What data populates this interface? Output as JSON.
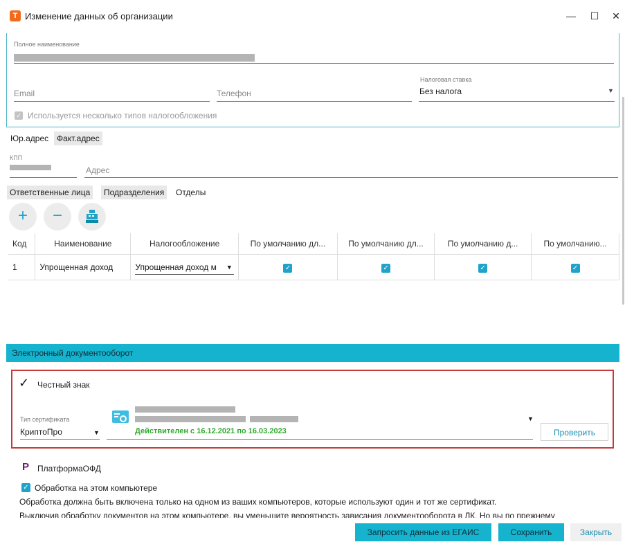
{
  "window": {
    "title": "Изменение данных об организации",
    "app_icon_letter": "Т",
    "controls": {
      "minimize": "—",
      "maximize": "☐",
      "close": "✕"
    }
  },
  "org": {
    "full_name_label": "Полное наименование",
    "email_placeholder": "Email",
    "phone_placeholder": "Телефон",
    "tax_rate_label": "Налоговая ставка",
    "tax_rate_value": "Без налога",
    "multi_tax_label": "Используется несколько типов налогообложения"
  },
  "address_tabs": [
    "Юр.адрес",
    "Факт.адрес"
  ],
  "address": {
    "kpp_label": "КПП",
    "address_placeholder": "Адрес"
  },
  "staff_tabs": [
    "Ответственные лица",
    "Подразделения",
    "Отделы"
  ],
  "toolbar": {
    "add": "+",
    "remove": "−"
  },
  "table": {
    "headers": [
      "Код",
      "Наименование",
      "Налогообложение",
      "По умолчанию дл...",
      "По умолчанию дл...",
      "По умолчанию д...",
      "По умолчанию..."
    ],
    "rows": [
      {
        "code": "1",
        "name": "Упрощенная доход",
        "tax": "Упрощенная доход м",
        "checks": [
          true,
          true,
          true,
          true
        ]
      }
    ]
  },
  "edo": {
    "section_title": "Электронный документооборот",
    "chestny_znak": "Честный знак",
    "cert_type_label": "Тип сертификата",
    "cert_type_value": "КриптоПро",
    "cert_validity": "Действителен с 16.12.2021 по 16.03.2023",
    "check_button": "Проверить",
    "platforma_ofd": "ПлатформаОФД",
    "processing_label": "Обработка на этом компьютере",
    "info_line1": "Обработка должна быть включена только на одном из ваших компьютеров, которые используют один и тот же сертификат.",
    "info_line2": "Выключив обработку документов на этом компьютере, вы уменьшите вероятность зависания документооборота в ЛК. Но вы по прежнему"
  },
  "footer": {
    "egais_button": "Запросить данные из ЕГАИС",
    "save_button": "Сохранить",
    "close_button": "Закрыть"
  },
  "colors": {
    "accent": "#16b3cf",
    "highlight_box": "#c73a3a",
    "valid_green": "#2fa82f",
    "ofd_purple": "#6a1b6e"
  }
}
